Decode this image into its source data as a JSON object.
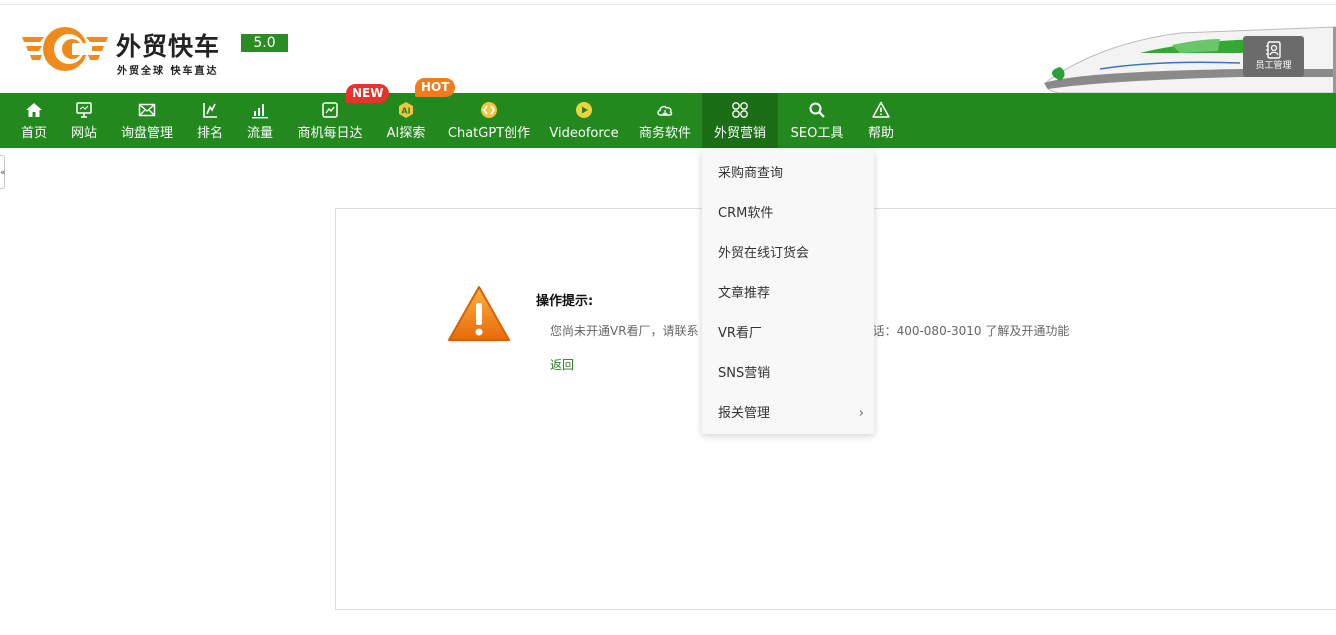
{
  "header": {
    "brand_name": "外贸快车",
    "version": "5.0",
    "slogan": "外贸全球 快车直达",
    "staff_button_label": "员工管理"
  },
  "nav": {
    "items": [
      {
        "label": "首页",
        "icon": "home-icon"
      },
      {
        "label": "网站",
        "icon": "monitor-icon"
      },
      {
        "label": "询盘管理",
        "icon": "mail-icon"
      },
      {
        "label": "排名",
        "icon": "rank-icon"
      },
      {
        "label": "流量",
        "icon": "bar-chart-icon"
      },
      {
        "label": "商机每日达",
        "icon": "trend-chart-icon"
      },
      {
        "label": "AI探索",
        "icon": "ai-icon"
      },
      {
        "label": "ChatGPT创作",
        "icon": "chatgpt-icon"
      },
      {
        "label": "Videoforce",
        "icon": "video-icon"
      },
      {
        "label": "商务软件",
        "icon": "cloud-icon"
      },
      {
        "label": "外贸营销",
        "icon": "grid-circles-icon"
      },
      {
        "label": "SEO工具",
        "icon": "search-icon"
      },
      {
        "label": "帮助",
        "icon": "warning-icon"
      }
    ],
    "badges": {
      "new": "NEW",
      "hot": "HOT"
    }
  },
  "dropdown": {
    "items": [
      "采购商查询",
      "CRM软件",
      "外贸在线订货会",
      "文章推荐",
      "VR看厂",
      "SNS营销",
      "报关管理"
    ],
    "submenu_arrow": "›"
  },
  "notice": {
    "title": "操作提示:",
    "message": "您尚未开通VR看厂，请联系",
    "message_tail": "服电话：400-080-3010 了解及开通功能",
    "back_link": "返回"
  },
  "side_tab_glyph": "«",
  "colors": {
    "nav_green": "#23881d",
    "nav_active": "#1b6e16",
    "version_bg": "#2a8c22",
    "logo_orange": "#f08a1c",
    "new_badge": "#e8322d",
    "hot_badge": "#f07c1c"
  }
}
